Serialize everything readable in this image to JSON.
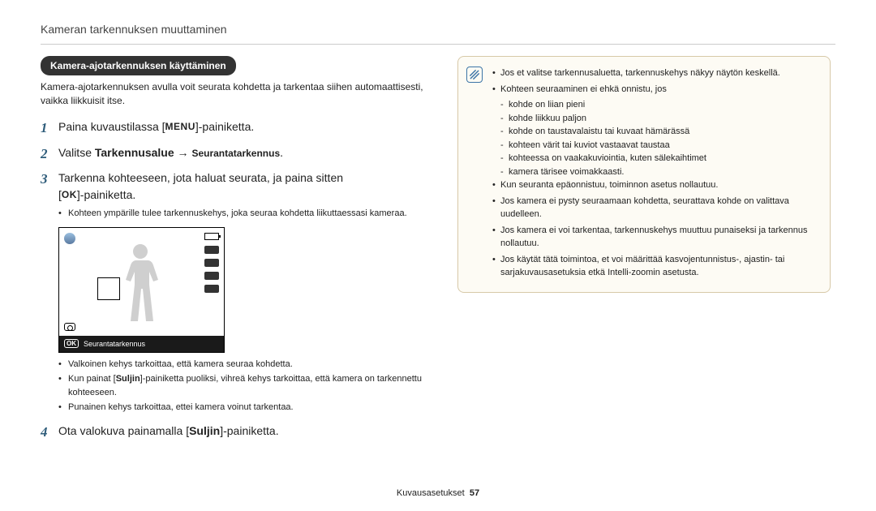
{
  "header": {
    "title": "Kameran tarkennuksen muuttaminen"
  },
  "pill": "Kamera-ajotarkennuksen käyttäminen",
  "intro": "Kamera-ajotarkennuksen avulla voit seurata kohdetta ja tarkentaa siihen automaattisesti, vaikka liikkuisit itse.",
  "steps": [
    {
      "num": "1",
      "pre": "Paina kuvaustilassa [",
      "chip": "MENU",
      "post": "]-painiketta."
    },
    {
      "num": "2",
      "pre": "Valitse ",
      "bold": "Tarkennusalue",
      "arrow": " → ",
      "bold2": "Seurantatarkennus",
      "post": "."
    },
    {
      "num": "3",
      "line1": "Tarkenna kohteeseen, jota haluat seurata, ja paina sitten",
      "line2_pre": "[",
      "line2_chip": "OK",
      "line2_post": "]-painiketta.",
      "sub": [
        "Kohteen ympärille tulee tarkennuskehys, joka seuraa kohdetta liikuttaessasi kameraa."
      ]
    }
  ],
  "screen": {
    "bar_ok": "OK",
    "bar_label": "Seurantatarkennus"
  },
  "post_screen_bullets": [
    "Valkoinen kehys tarkoittaa, että kamera seuraa kohdetta.",
    {
      "pre": "Kun painat [",
      "bold": "Suljin",
      "post": "]-painiketta puoliksi, vihreä kehys tarkoittaa, että kamera on tarkennettu kohteeseen."
    },
    "Punainen kehys tarkoittaa, ettei kamera voinut tarkentaa."
  ],
  "step4": {
    "num": "4",
    "pre": "Ota valokuva painamalla [",
    "bold": "Suljin",
    "post": "]-painiketta."
  },
  "info": {
    "l1": [
      "Jos et valitse tarkennusaluetta, tarkennuskehys näkyy näytön keskellä.",
      "Kohteen seuraaminen ei ehkä onnistu, jos"
    ],
    "l2": [
      "kohde on liian pieni",
      "kohde liikkuu paljon",
      "kohde on taustavalaistu tai kuvaat hämärässä",
      "kohteen värit tai kuviot vastaavat taustaa",
      "kohteessa on vaakakuviointia, kuten sälekaihtimet",
      "kamera tärisee voimakkaasti."
    ],
    "l1b": [
      "Kun seuranta epäonnistuu, toiminnon asetus nollautuu.",
      "Jos kamera ei pysty seuraamaan kohdetta, seurattava kohde on valittava uudelleen.",
      "Jos kamera ei voi tarkentaa, tarkennuskehys muuttuu punaiseksi ja tarkennus nollautuu.",
      "Jos käytät tätä toimintoa, et voi määrittää kasvojentunnistus-, ajastin- tai sarjakuvausasetuksia etkä Intelli-zoomin asetusta."
    ]
  },
  "footer": {
    "label": "Kuvausasetukset",
    "page": "57"
  }
}
